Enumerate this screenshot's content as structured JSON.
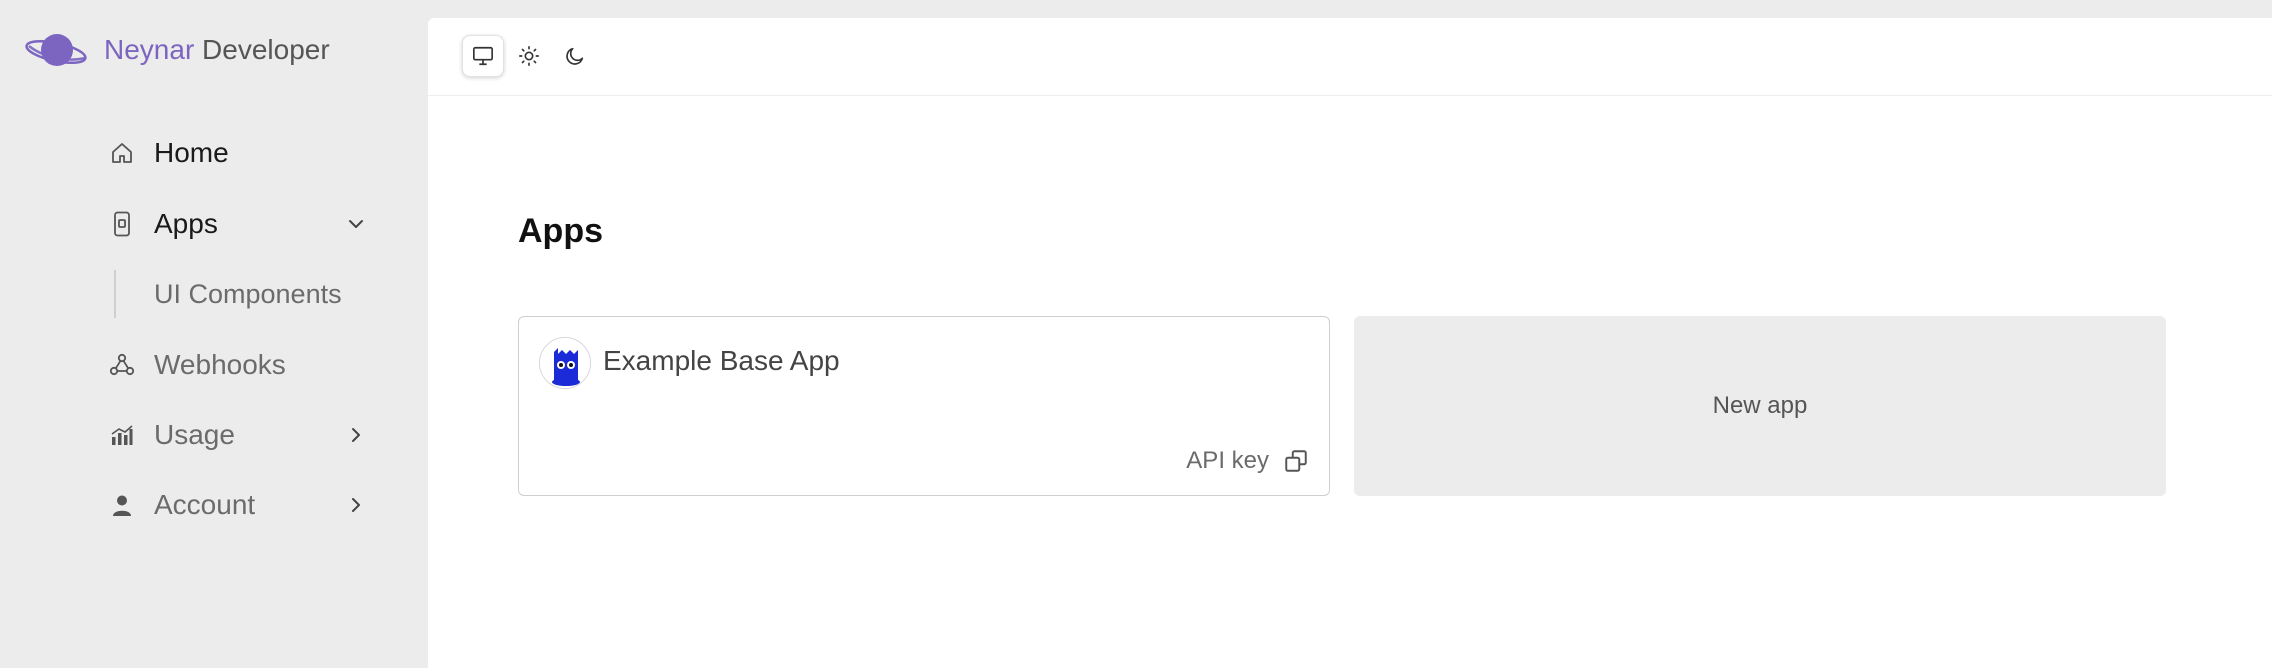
{
  "brand": {
    "name_part1": "Neynar",
    "name_part2": "Developer",
    "logo_icon": "planet-icon",
    "accent": "#7c65c1"
  },
  "sidebar": {
    "items": [
      {
        "label": "Home",
        "icon": "home-icon"
      },
      {
        "label": "Apps",
        "icon": "mobile-device-icon",
        "expanded": true
      },
      {
        "label": "UI Components"
      },
      {
        "label": "Webhooks",
        "icon": "webhook-icon"
      },
      {
        "label": "Usage",
        "icon": "bar-chart-icon"
      },
      {
        "label": "Account",
        "icon": "user-icon"
      }
    ]
  },
  "theme_toggle": {
    "options": [
      "monitor-icon",
      "sun-icon",
      "moon-icon"
    ],
    "selected": "monitor-icon"
  },
  "main": {
    "title": "Apps",
    "apps": [
      {
        "name": "Example Base App",
        "api_key_label": "API key"
      }
    ],
    "new_app_label": "New app"
  }
}
